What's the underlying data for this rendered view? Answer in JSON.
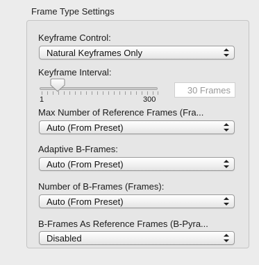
{
  "section": {
    "title": "Frame Type Settings"
  },
  "keyframe_control": {
    "label": "Keyframe Control:",
    "value": "Natural Keyframes Only"
  },
  "keyframe_interval": {
    "label": "Keyframe Interval:",
    "min_label": "1",
    "max_label": "300",
    "frames_value": "30 Frames",
    "slider_fraction": 0.1
  },
  "max_reference_frames": {
    "label": "Max Number of Reference Frames (Fra...",
    "value": "Auto (From Preset)"
  },
  "adaptive_b_frames": {
    "label": "Adaptive B-Frames:",
    "value": "Auto (From Preset)"
  },
  "number_of_b_frames": {
    "label": "Number of B-Frames (Frames):",
    "value": "Auto (From Preset)"
  },
  "b_frames_as_reference": {
    "label": "B-Frames As Reference Frames (B-Pyra...",
    "value": "Disabled"
  }
}
